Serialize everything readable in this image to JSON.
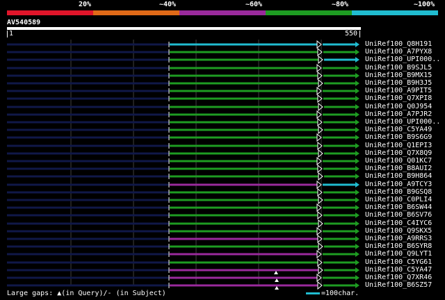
{
  "colors": {
    "red": "#e0152a",
    "orange": "#e06a18",
    "purple": "#9a2a9c",
    "green": "#1e9c22",
    "cyan": "#20bcd0",
    "navy": "#101848",
    "grid": "#404040"
  },
  "scale": {
    "labels": [
      "20%",
      "~40%",
      "~60%",
      "~80%",
      "~100%"
    ]
  },
  "query": {
    "name": "AV540589",
    "start": "1",
    "end": "550"
  },
  "hits": [
    {
      "name": "UniRef100_Q8H191",
      "color": "cyan"
    },
    {
      "name": "UniRef100_A7PYX8",
      "color": "green"
    },
    {
      "name": "UniRef100_UPI000..",
      "color": "green"
    },
    {
      "name": "UniRef100_B9SJL5",
      "color": "green"
    },
    {
      "name": "UniRef100_B9MX15",
      "color": "green"
    },
    {
      "name": "UniRef100_B9H3J5",
      "color": "green"
    },
    {
      "name": "UniRef100_A9PIT5",
      "color": "green"
    },
    {
      "name": "UniRef100_Q7XPI8",
      "color": "green"
    },
    {
      "name": "UniRef100_Q0J954",
      "color": "green"
    },
    {
      "name": "UniRef100_A7PJR2",
      "color": "green"
    },
    {
      "name": "UniRef100_UPI000..",
      "color": "green"
    },
    {
      "name": "UniRef100_C5YA49",
      "color": "green"
    },
    {
      "name": "UniRef100_B9S6G9",
      "color": "green"
    },
    {
      "name": "UniRef100_Q1EPI3",
      "color": "green"
    },
    {
      "name": "UniRef100_Q7X8Q9",
      "color": "green"
    },
    {
      "name": "UniRef100_Q01KC7",
      "color": "green"
    },
    {
      "name": "UniRef100_B8AUI2",
      "color": "green"
    },
    {
      "name": "UniRef100_B9H864",
      "color": "green"
    },
    {
      "name": "UniRef100_A9TCY3",
      "color": "purple"
    },
    {
      "name": "UniRef100_B9GSQ8",
      "color": "green"
    },
    {
      "name": "UniRef100_C0PLI4",
      "color": "green"
    },
    {
      "name": "UniRef100_B6SW44",
      "color": "green"
    },
    {
      "name": "UniRef100_B6SV76",
      "color": "green"
    },
    {
      "name": "UniRef100_C4IYC6",
      "color": "green"
    },
    {
      "name": "UniRef100_Q9SKX5",
      "color": "green"
    },
    {
      "name": "UniRef100_A9RRS3",
      "color": "purple"
    },
    {
      "name": "UniRef100_B6SYR8",
      "color": "green"
    },
    {
      "name": "UniRef100_Q9LYT1",
      "color": "purple"
    },
    {
      "name": "UniRef100_C5YG61",
      "color": "green"
    },
    {
      "name": "UniRef100_C5YA47",
      "color": "purple"
    },
    {
      "name": "UniRef100_Q7XR46",
      "color": "purple"
    },
    {
      "name": "UniRef100_B6SZ57",
      "color": "purple"
    }
  ],
  "legend": {
    "large_gaps": "Large gaps:",
    "in_query": "(in Query)/",
    "in_subject": "- (in Subject)",
    "scale_text": "=100char."
  }
}
